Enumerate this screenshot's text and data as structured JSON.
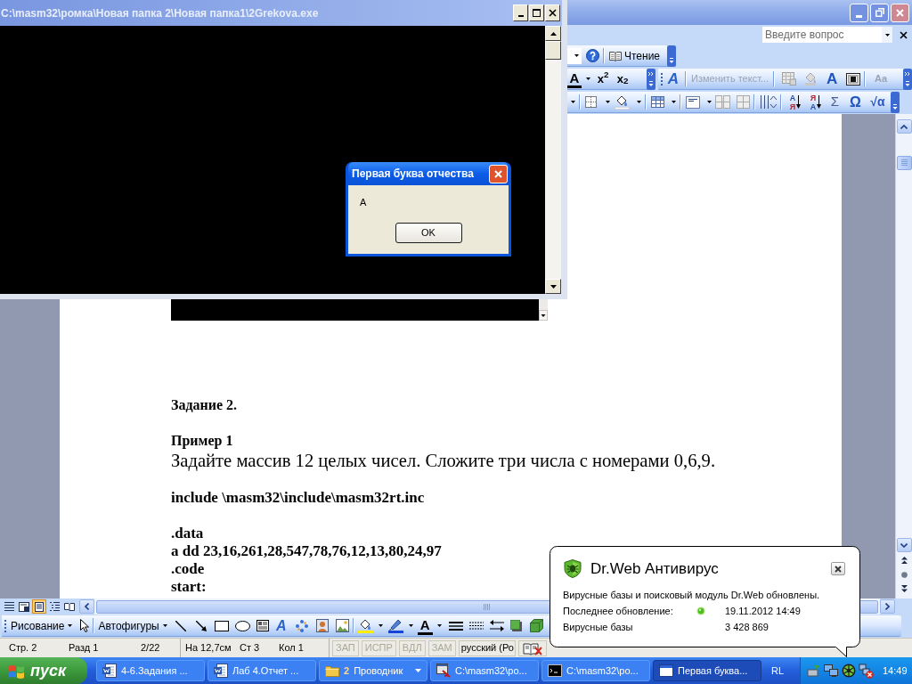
{
  "console_window": {
    "title": "C:\\masm32\\ромка\\Новая папка 2\\Новая папка1\\2Grekova.exe"
  },
  "message_box": {
    "title": "Первая буква отчества",
    "text": "А",
    "button": "OK"
  },
  "word": {
    "help_box": {
      "placeholder": "Введите вопрос"
    },
    "standard_toolbar": {
      "reading_button": "Чтение"
    },
    "formatting_toolbar": {
      "font_color_button": "A",
      "superscript_button": "x$^{2}$",
      "subscript_button": "x$_{2}$"
    },
    "wordart_toolbar": {
      "wordart_button": "A",
      "edit_text_button": {
        "label": "Изменить текст...",
        "disabled": true
      },
      "shape_button": "A",
      "same_height_button": {
        "label": "Aa",
        "disabled": true
      }
    },
    "tables_toolbar": {
      "sort_buttons": [
        {
          "top": "А",
          "bottom": "Я"
        },
        {
          "top": "Я",
          "bottom": "А"
        }
      ],
      "symbol_buttons": [
        "Σ",
        "Ω",
        "√α"
      ]
    },
    "document": {
      "blocks": [
        [
          {
            "kind": "heading",
            "text": "Задание 2."
          }
        ],
        [
          {
            "kind": "heading",
            "text": "Пример 1"
          },
          {
            "kind": "task",
            "text": "Задайте массив 12 целых чисел. Сложите три числа с номерами 0,6,9."
          }
        ],
        [
          {
            "kind": "code",
            "text": "include \\masm32\\include\\masm32rt.inc"
          }
        ],
        [
          {
            "kind": "code",
            "text": ".data"
          },
          {
            "kind": "code",
            "text": "a dd 23,16,261,28,547,78,76,12,13,80,24,97"
          },
          {
            "kind": "code",
            "text": ".code"
          },
          {
            "kind": "code",
            "text": "start:"
          }
        ]
      ]
    },
    "view_buttons": [
      {
        "selected": false
      },
      {
        "selected": false
      },
      {
        "selected": true
      },
      {
        "selected": false
      },
      {
        "selected": false
      }
    ],
    "drawing_toolbar": {
      "drawing_menu": "Рисование",
      "autoshapes_menu": "Автофигуры",
      "wordart_button": "A",
      "font_color_button": "A"
    },
    "status_bar": {
      "fields": [
        "Стр. 2",
        "Разд 1",
        "2/22",
        "На 12,7см",
        "Ст 3",
        "Кол 1"
      ],
      "modes": [
        {
          "label": "ЗАП",
          "on": false
        },
        {
          "label": "ИСПР",
          "on": false
        },
        {
          "label": "ВДЛ",
          "on": false
        },
        {
          "label": "ЗАМ",
          "on": false
        }
      ],
      "language": "русский (Ро"
    }
  },
  "notification": {
    "title": "Dr.Web Антивирус",
    "message": "Вирусные базы и поисковый модуль Dr.Web обновлены.",
    "rows": [
      {
        "label": "Последнее обновление:",
        "value": "19.11.2012 14:49",
        "status_ok": true
      },
      {
        "label": "Вирусные базы",
        "value": "3 428 869"
      }
    ]
  },
  "taskbar": {
    "start_button": "пуск",
    "buttons": [
      {
        "kind": "document",
        "label": "4-6.Задания ...",
        "selected": false
      },
      {
        "kind": "document",
        "label": "Лаб 4.Отчет ...",
        "selected": false
      },
      {
        "kind": "group",
        "count": "2",
        "label": "Проводник",
        "selected": false
      },
      {
        "kind": "program",
        "label": "C:\\masm32\\ро...",
        "selected": false
      },
      {
        "kind": "console",
        "label": "C:\\masm32\\ро...",
        "selected": false
      },
      {
        "kind": "window",
        "label": "Первая буква...",
        "selected": true
      }
    ],
    "language": "RL",
    "clock": "14:49"
  }
}
